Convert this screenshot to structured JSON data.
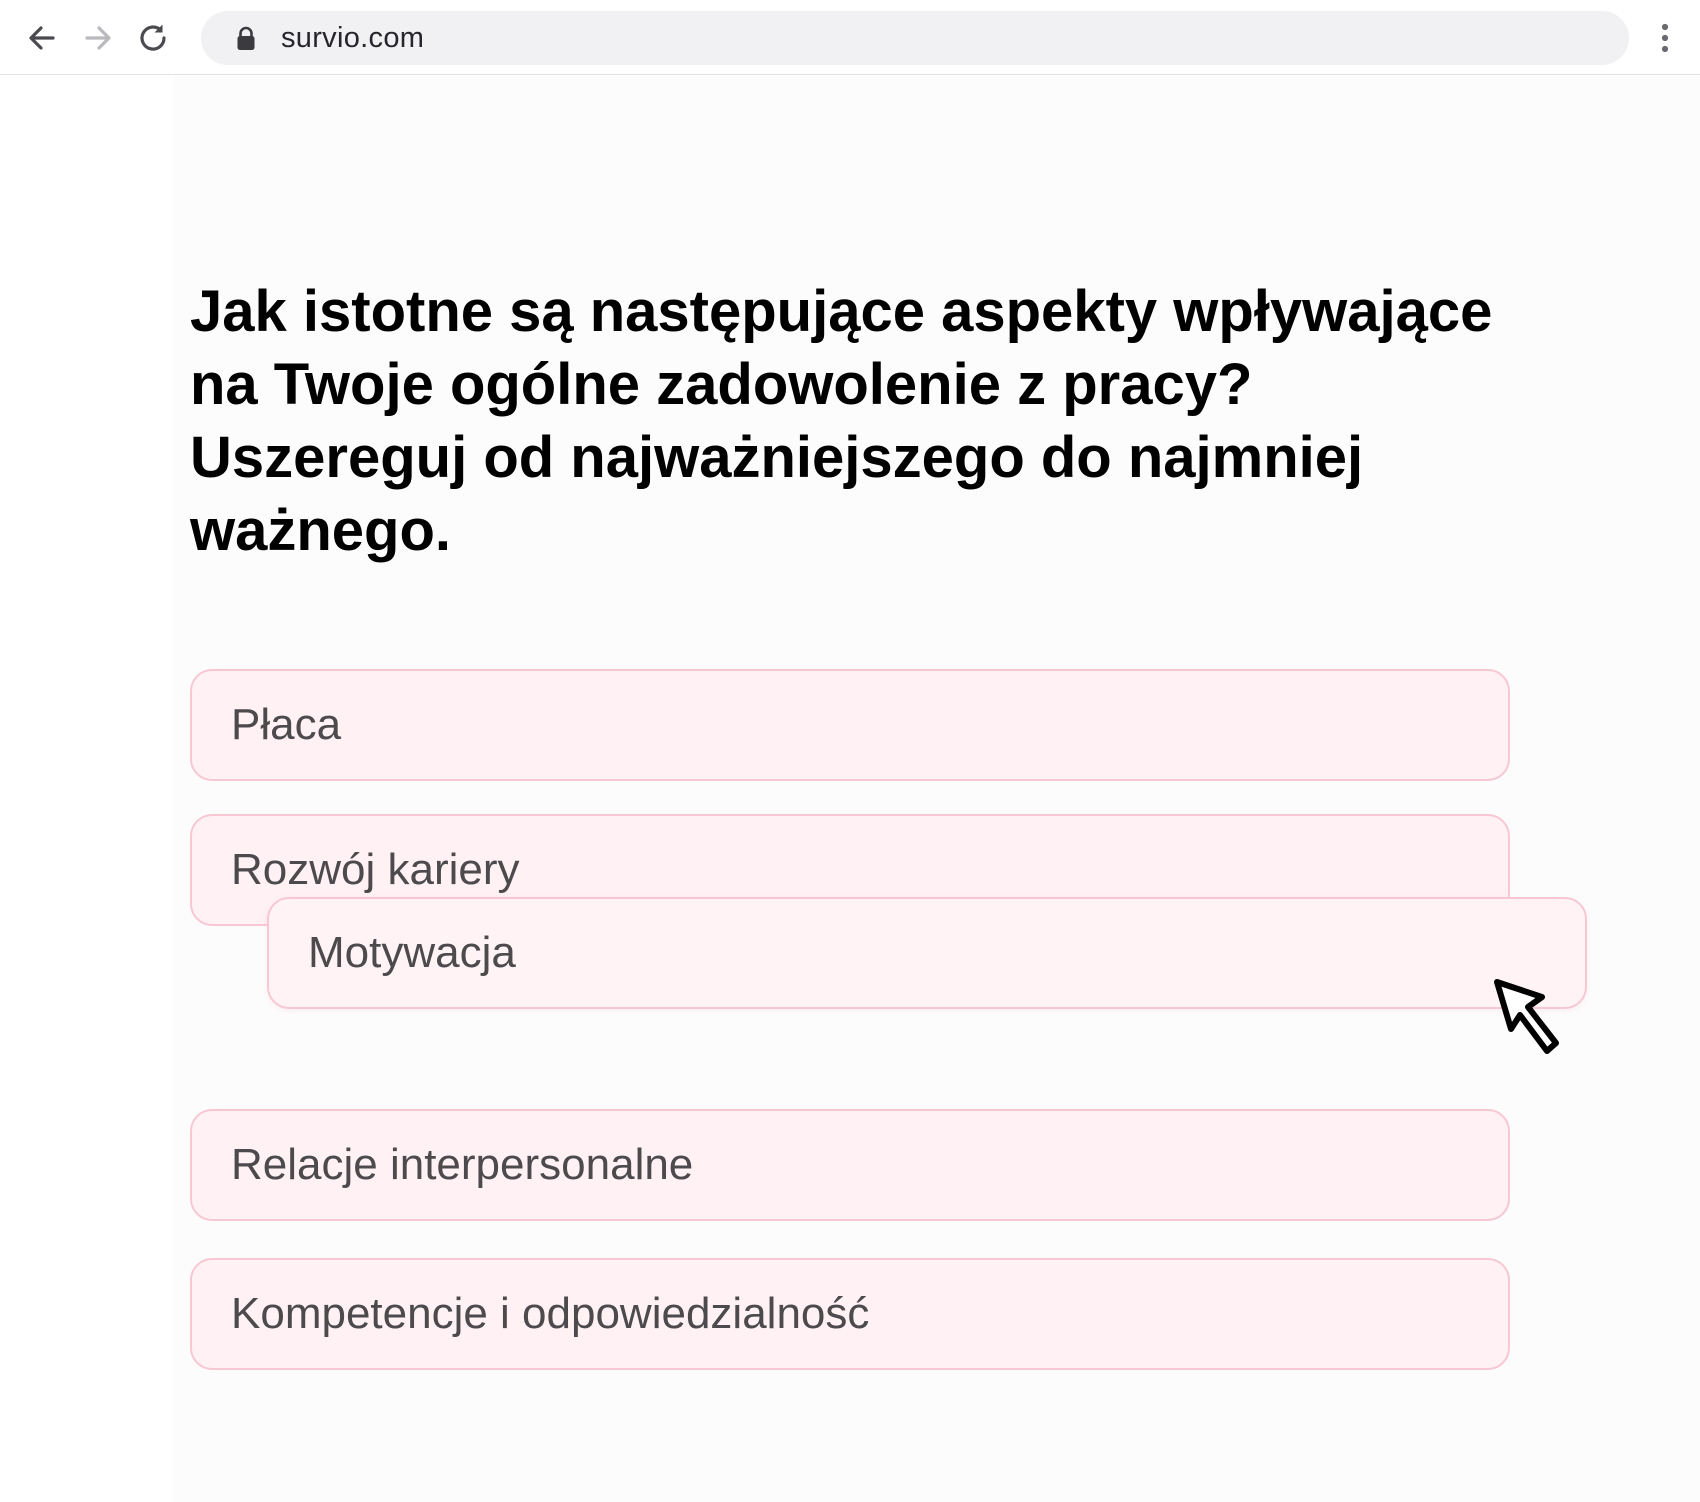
{
  "browser": {
    "url": "survio.com",
    "icons": {
      "back": "arrow-left-icon",
      "forward": "arrow-right-icon",
      "reload": "reload-icon",
      "lock": "lock-icon",
      "menu": "vertical-dots-icon"
    }
  },
  "survey": {
    "question": "Jak istotne są następujące aspekty wpływające na Twoje ogólne zadowolenie z pracy? Uszereguj od najważniejszego do najmniej ważnego.",
    "options": [
      "Płaca",
      "Rozwój kariery",
      "Motywacja",
      "Relacje interpersonalne",
      "Kompetencje i odpowiedzialność"
    ],
    "dragged_option": "Motywacja"
  },
  "colors": {
    "option_border": "#f7c8d3",
    "option_background": "#fff1f4",
    "option_text": "#4c4a4d",
    "question_text": "#000000",
    "address_bar": "#f1f1f3"
  }
}
